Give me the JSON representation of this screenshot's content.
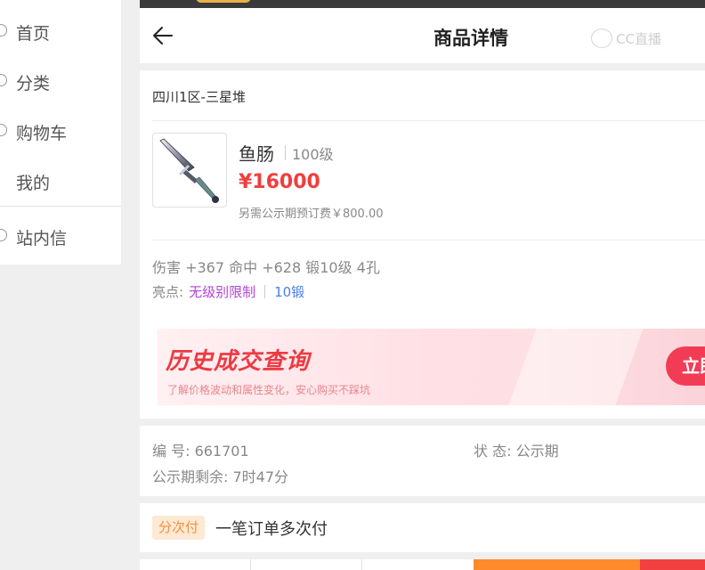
{
  "sidebar": {
    "items": [
      {
        "label": "首页"
      },
      {
        "label": "分类"
      },
      {
        "label": "购物车"
      },
      {
        "label": "我的"
      },
      {
        "label": "站内信"
      }
    ]
  },
  "header": {
    "title": "商品详情",
    "back_icon": "arrow-left-icon",
    "watermark": "CC直播"
  },
  "product": {
    "server": "四川1区-三星堆",
    "name": "鱼肠",
    "level": "100级",
    "price": "¥16000",
    "deposit_note": "另需公示期预订费￥800.00",
    "attributes": "伤害 +367 命中 +628 锻10级 4孔",
    "highlights_label": "亮点:",
    "highlights": [
      "无级别限制",
      "10锻"
    ]
  },
  "banner": {
    "title": "历史成交查询",
    "subtitle": "了解价格波动和属性变化，安心购买不踩坑",
    "button_label": "立即"
  },
  "details": {
    "serial": "编 号: 661701",
    "status": "状 态: 公示期",
    "remaining": "公示期剩余: 7时47分"
  },
  "installment": {
    "badge": "分次付",
    "text": "一笔订单多次付"
  },
  "colors": {
    "price_red": "#f03e3e",
    "tag_purple": "#b244d6",
    "tag_blue": "#4a7ee8",
    "badge_orange": "#f2913b",
    "buy_orange": "#ff8a2b",
    "buy_red": "#f24040"
  }
}
